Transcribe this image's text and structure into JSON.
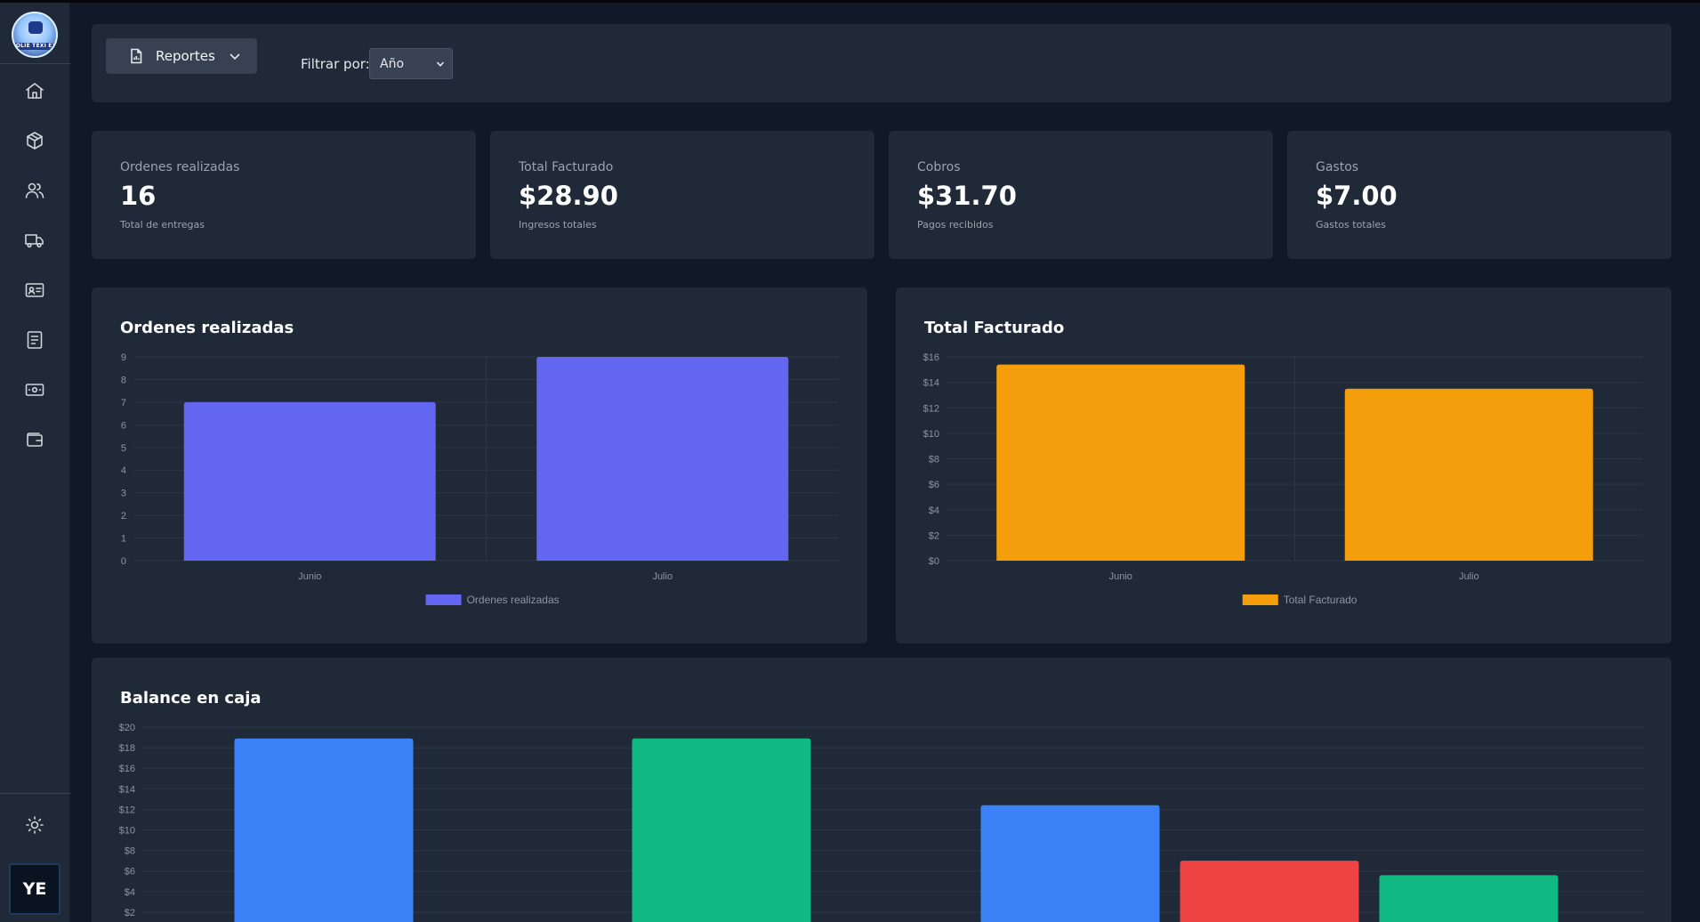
{
  "app": {
    "logo_text": "ROLIE TEXI EXPRESS",
    "user_initials": "YE"
  },
  "sidebar": {
    "items": [
      {
        "icon": "home-icon"
      },
      {
        "icon": "package-icon"
      },
      {
        "icon": "users-icon"
      },
      {
        "icon": "truck-icon"
      },
      {
        "icon": "id-card-icon"
      },
      {
        "icon": "document-list-icon"
      },
      {
        "icon": "cash-icon"
      },
      {
        "icon": "wallet-icon"
      }
    ],
    "theme_icon": "sun-icon"
  },
  "header": {
    "reports_label": "Reportes",
    "filter_label": "Filtrar por:",
    "filter_value": "Año"
  },
  "stats": [
    {
      "label": "Ordenes realizadas",
      "value": "16",
      "sub": "Total de entregas"
    },
    {
      "label": "Total Facturado",
      "value": "$28.90",
      "sub": "Ingresos totales"
    },
    {
      "label": "Cobros",
      "value": "$31.70",
      "sub": "Pagos recibidos"
    },
    {
      "label": "Gastos",
      "value": "$7.00",
      "sub": "Gastos totales"
    }
  ],
  "colors": {
    "orders": "#6366f1",
    "billing": "#f59e0b",
    "blue": "#3b82f6",
    "green": "#10b981",
    "red": "#ef4444"
  },
  "chart_data": [
    {
      "type": "bar",
      "title": "Ordenes realizadas",
      "categories": [
        "Junio",
        "Julio"
      ],
      "series": [
        {
          "name": "Ordenes realizadas",
          "values": [
            7,
            9
          ],
          "color": "#6366f1"
        }
      ],
      "ylim": [
        0,
        9
      ],
      "yticks": [
        "0",
        "1",
        "2",
        "3",
        "4",
        "5",
        "6",
        "7",
        "8",
        "9"
      ],
      "legend": "bottom"
    },
    {
      "type": "bar",
      "title": "Total Facturado",
      "categories": [
        "Junio",
        "Julio"
      ],
      "series": [
        {
          "name": "Total Facturado",
          "values": [
            15.4,
            13.5
          ],
          "color": "#f59e0b"
        }
      ],
      "ylim": [
        0,
        16
      ],
      "yticks": [
        "$0",
        "$2",
        "$4",
        "$6",
        "$8",
        "$10",
        "$12",
        "$14",
        "$16"
      ],
      "legend": "bottom"
    },
    {
      "type": "bar",
      "title": "Balance en caja",
      "ylim": [
        0,
        20
      ],
      "yticks": [
        "$2",
        "$4",
        "$6",
        "$8",
        "$10",
        "$12",
        "$14",
        "$16",
        "$18",
        "$20"
      ],
      "bars": [
        {
          "value": 18.9,
          "color": "#3b82f6"
        },
        {
          "value": 18.9,
          "color": "#10b981"
        },
        {
          "value": 12.4,
          "color": "#3b82f6"
        },
        {
          "value": 7.0,
          "color": "#ef4444"
        },
        {
          "value": 5.6,
          "color": "#10b981"
        }
      ]
    }
  ]
}
